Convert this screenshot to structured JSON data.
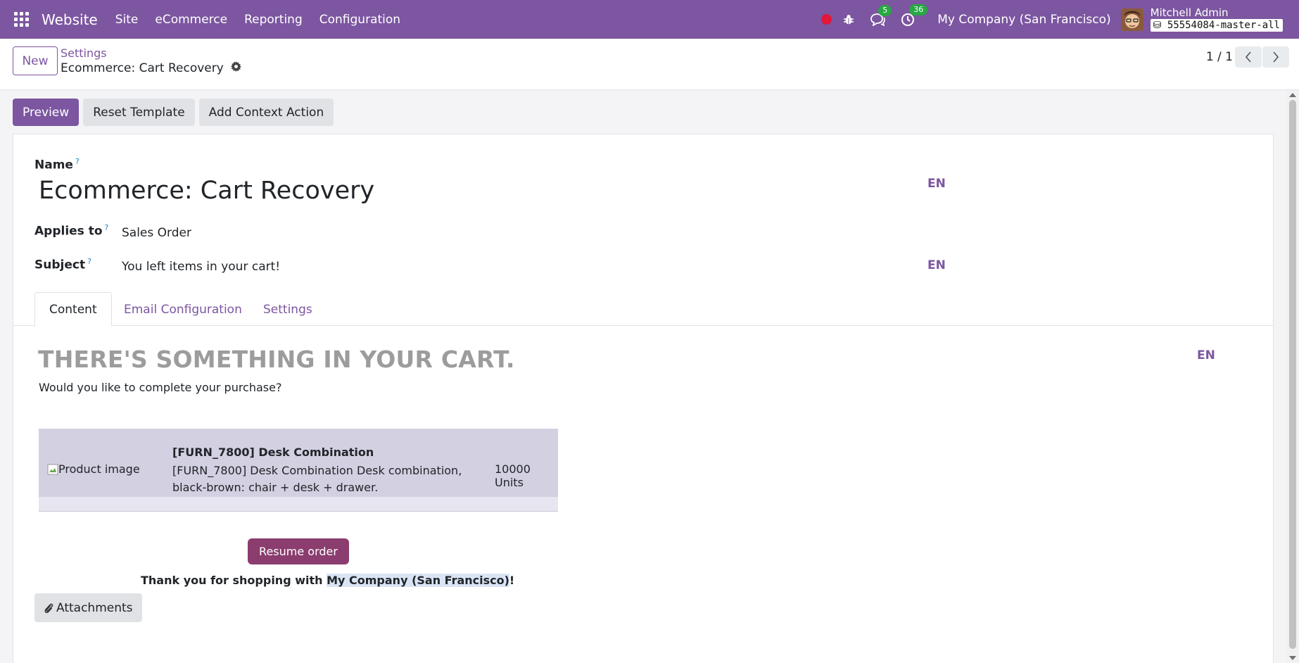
{
  "navbar": {
    "app_name": "Website",
    "menu": [
      "Site",
      "eCommerce",
      "Reporting",
      "Configuration"
    ],
    "messages_count": "5",
    "activities_count": "36",
    "company": "My Company (San Francisco)",
    "user_name": "Mitchell Admin",
    "db_name": "55554084-master-all",
    "accent_color": "#7c56a0"
  },
  "control_panel": {
    "new_label": "New",
    "breadcrumb_parent": "Settings",
    "breadcrumb_current": "Ecommerce: Cart Recovery",
    "pager": "1 / 1"
  },
  "actions": {
    "preview": "Preview",
    "reset_template": "Reset Template",
    "add_context_action": "Add Context Action"
  },
  "form": {
    "name_label": "Name",
    "help_marker": "?",
    "name_value": "Ecommerce: Cart Recovery",
    "applies_to_label": "Applies to",
    "applies_to_value": "Sales Order",
    "subject_label": "Subject",
    "subject_value": "You left items in your cart!",
    "lang": "EN"
  },
  "tabs": [
    "Content",
    "Email Configuration",
    "Settings"
  ],
  "content": {
    "headline": "THERE'S SOMETHING IN YOUR CART.",
    "subline": "Would you like to complete your purchase?",
    "product": {
      "image_alt": "Product image",
      "title": "[FURN_7800] Desk Combination",
      "description": "[FURN_7800] Desk Combination Desk combination, black-brown: chair + desk + drawer.",
      "quantity": "10000 Units"
    },
    "resume_label": "Resume order",
    "thanks_prefix": "Thank you for shopping with ",
    "thanks_company": "My Company (San Francisco)",
    "thanks_suffix": "!",
    "attachments_label": "Attachments"
  }
}
